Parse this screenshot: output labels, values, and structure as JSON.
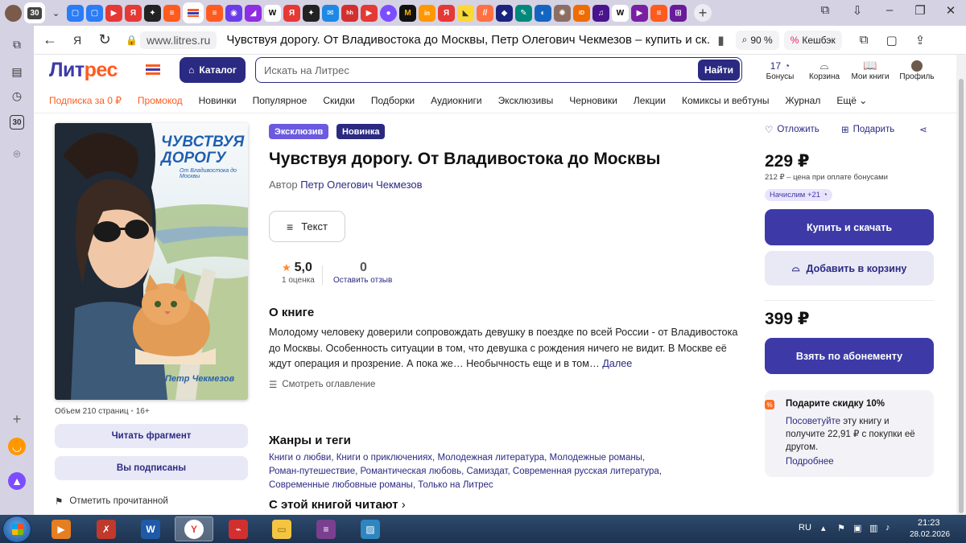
{
  "browser": {
    "tab_count_badge": "30",
    "address": {
      "domain": "www.litres.ru",
      "page_title": "Чувствуя дорогу. От Владивостока до Москвы, Петр Олегович Чекмезов – купить и ск...",
      "zoom": "90 %",
      "cashback": "Кешбэк"
    },
    "sidebar_badge": "30"
  },
  "site": {
    "logo_main": "Лит",
    "logo_accent": "рес",
    "catalog_label": "Каталог",
    "search_placeholder": "Искать на Литрес",
    "search_button": "Найти",
    "icons": [
      {
        "label": "Бонусы",
        "value": "17"
      },
      {
        "label": "Корзина"
      },
      {
        "label": "Мои книги"
      },
      {
        "label": "Профиль"
      }
    ],
    "menu": [
      {
        "label": "Подписка за 0 ₽",
        "highlight": true
      },
      {
        "label": "Промокод",
        "highlight": true
      },
      {
        "label": "Новинки"
      },
      {
        "label": "Популярное"
      },
      {
        "label": "Скидки"
      },
      {
        "label": "Подборки"
      },
      {
        "label": "Аудиокниги"
      },
      {
        "label": "Эксклюзивы"
      },
      {
        "label": "Черновики"
      },
      {
        "label": "Лекции"
      },
      {
        "label": "Комиксы и вебтуны"
      },
      {
        "label": "Журнал"
      },
      {
        "label": "Ещё"
      }
    ]
  },
  "book": {
    "cover": {
      "title": "ЧУВСТВУЯ ДОРОГУ",
      "subtitle": "От Владивостока до Москвы",
      "author": "Петр Чекмезов"
    },
    "volume": "Объем 210 страниц",
    "age": "16+",
    "read_fragment": "Читать фрагмент",
    "subscribed": "Вы подписаны",
    "mark_read": "Отметить прочитанной",
    "badges": [
      "Эксклюзив",
      "Новинка"
    ],
    "title": "Чувствуя дорогу. От Владивостока до Москвы",
    "author_prefix": "Автор",
    "author": "Петр Олегович Чекмезов",
    "format_button": "Текст",
    "rating": "5,0",
    "rating_count": "1 оценка",
    "reviews": "0",
    "leave_review": "Оставить отзыв",
    "about_heading": "О книге",
    "description": "Молодому человеку доверили сопровождать девушку в поездке по всей России - от Владивостока до Москвы. Особенность ситуации в том, что девушка с рождения ничего не видит. В Москве её ждут операция и прозрение. А пока же… Необычность еще и в том…",
    "more": "Далее",
    "toc": "Смотреть оглавление",
    "genres_heading": "Жанры и теги",
    "genres": [
      "Книги о любви",
      "Книги о приключениях",
      "Молодежная литература",
      "Молодежные романы",
      "Роман-путешествие",
      "Романтическая любовь",
      "Самиздат",
      "Современная русская литература",
      "Современные любовные романы",
      "Только на Литрес"
    ],
    "also_heading": "С этой книгой читают"
  },
  "purchase": {
    "defer": "Отложить",
    "gift": "Подарить",
    "price": "229 ₽",
    "bonus_price": "212 ₽ – цена при оплате бонусами",
    "bonus_award": "Начислим +21",
    "buy": "Купить и скачать",
    "add_cart": "Добавить в корзину",
    "sub_price": "399 ₽",
    "subscribe": "Взять по абонементу",
    "promo_title": "Подарите скидку 10%",
    "promo_link": "Посоветуйте",
    "promo_text": " эту книгу и получите 22,91 ₽ с покупки её другом.",
    "promo_more": "Подробнее"
  },
  "taskbar": {
    "lang": "RU",
    "time": "21:23",
    "date": "28.02.2026"
  },
  "colors": {
    "brand": "#3d3aa8",
    "brand_dark": "#2b2a82",
    "accent": "#ff5b1e"
  }
}
